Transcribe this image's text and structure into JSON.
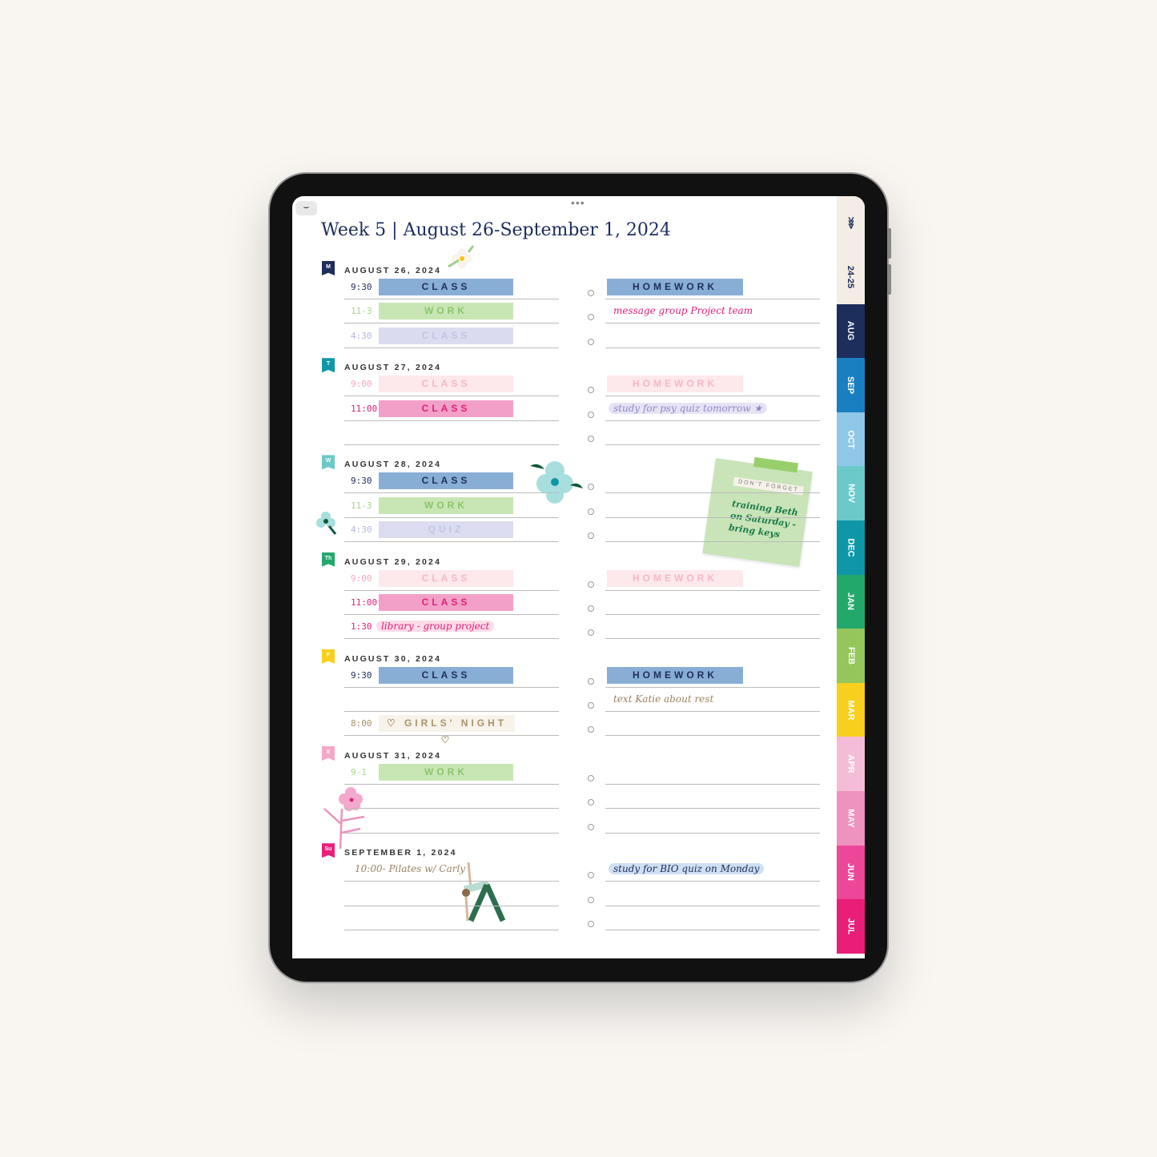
{
  "header": {
    "title": "Week 5  |  August 26-September 1, 2024",
    "collapse_icon": "chevron-down-icon",
    "more_icon": "ellipsis-icon"
  },
  "days": [
    {
      "badge": "M",
      "badge_color": "#1d2d5c",
      "date": "AUGUST 26, 2024",
      "left": [
        {
          "time": "9:30",
          "label": "CLASS",
          "style": "blue"
        },
        {
          "time": "11-3",
          "label": "WORK",
          "style": "green"
        },
        {
          "time": "4:30",
          "label": "CLASS",
          "style": "lavender"
        }
      ],
      "right": [
        {
          "label": "HOMEWORK",
          "style": "blue"
        },
        {
          "text": "message group Project team",
          "style": "hand-pink"
        },
        {}
      ]
    },
    {
      "badge": "T",
      "badge_color": "#0f97a8",
      "date": "AUGUST 27, 2024",
      "left": [
        {
          "time": "9:00",
          "label": "CLASS",
          "style": "pinklight"
        },
        {
          "time": "11:00",
          "label": "CLASS",
          "style": "pink"
        },
        {}
      ],
      "right": [
        {
          "label": "HOMEWORK",
          "style": "pinklight"
        },
        {
          "text": "study for psy quiz tomorrow ★",
          "style": "hand-lavender"
        },
        {}
      ]
    },
    {
      "badge": "W",
      "badge_color": "#6cc9c9",
      "date": "AUGUST 28, 2024",
      "left": [
        {
          "time": "9:30",
          "label": "CLASS",
          "style": "blue"
        },
        {
          "time": "11-3",
          "label": "WORK",
          "style": "green"
        },
        {
          "time": "4:30",
          "label": "QUIZ",
          "style": "lavender"
        }
      ],
      "right": [
        {},
        {},
        {}
      ]
    },
    {
      "badge": "Th",
      "badge_color": "#23a86b",
      "date": "AUGUST 29, 2024",
      "left": [
        {
          "time": "9:00",
          "label": "CLASS",
          "style": "pinklight"
        },
        {
          "time": "11:00",
          "label": "CLASS",
          "style": "pink"
        },
        {
          "time": "1:30",
          "text": "library - group project",
          "style": "hand-pinkhl"
        }
      ],
      "right": [
        {
          "label": "HOMEWORK",
          "style": "pinklight"
        },
        {},
        {}
      ]
    },
    {
      "badge": "F",
      "badge_color": "#f8cf1c",
      "date": "AUGUST 30, 2024",
      "left": [
        {
          "time": "9:30",
          "label": "CLASS",
          "style": "blue"
        },
        {},
        {
          "time": "8:00",
          "label": "♡ GIRLS' NIGHT ♡",
          "style": "beige"
        }
      ],
      "right": [
        {
          "label": "HOMEWORK",
          "style": "blue"
        },
        {
          "text": "text Katie about rest",
          "style": "hand-brown"
        },
        {}
      ]
    },
    {
      "badge": "S",
      "badge_color": "#f2a8c9",
      "date": "AUGUST 31, 2024",
      "left": [
        {
          "time": "9-1",
          "label": "WORK",
          "style": "green"
        },
        {},
        {}
      ],
      "right": [
        {},
        {},
        {}
      ]
    },
    {
      "badge": "Su",
      "badge_color": "#e91e78",
      "date": "SEPTEMBER 1, 2024",
      "left": [
        {
          "time": "",
          "text": "10:00- Pilates w/ Carly",
          "style": "hand-brown"
        },
        {},
        {}
      ],
      "right": [
        {
          "text": "study for BIO quiz on Monday",
          "style": "hand-bluehl"
        },
        {},
        {}
      ]
    }
  ],
  "sticky": {
    "heading": "DON'T FORGET",
    "note": "training Beth on Saturday - bring keys"
  },
  "tabs": [
    {
      "label": "",
      "icon": "pineapple-icon",
      "color": "#f3ede5",
      "text": "#1d2d5c"
    },
    {
      "label": "24-25",
      "color": "#f3ede5",
      "text": "#1d2d5c"
    },
    {
      "label": "AUG",
      "color": "#1d2d5c",
      "text": "#fff"
    },
    {
      "label": "SEP",
      "color": "#1a7fc1",
      "text": "#fff"
    },
    {
      "label": "OCT",
      "color": "#8fc7e8",
      "text": "#fff"
    },
    {
      "label": "NOV",
      "color": "#6cc9c9",
      "text": "#fff"
    },
    {
      "label": "DEC",
      "color": "#0f97a8",
      "text": "#fff"
    },
    {
      "label": "JAN",
      "color": "#23a86b",
      "text": "#fff"
    },
    {
      "label": "FEB",
      "color": "#94c65b",
      "text": "#fff"
    },
    {
      "label": "MAR",
      "color": "#f8cf1c",
      "text": "#fff"
    },
    {
      "label": "APR",
      "color": "#f4bcd6",
      "text": "#fff"
    },
    {
      "label": "MAY",
      "color": "#ee93bf",
      "text": "#fff"
    },
    {
      "label": "JUN",
      "color": "#ec4798",
      "text": "#fff"
    },
    {
      "label": "JUL",
      "color": "#e91e78",
      "text": "#fff"
    }
  ],
  "styles": {
    "blue": {
      "bg": "#88aed6",
      "fg": "#1d2d5c",
      "time": "#1d2d5c"
    },
    "green": {
      "bg": "#c8e6b4",
      "fg": "#8cc46a",
      "time": "#a9d58c"
    },
    "lavender": {
      "bg": "#dcdcf0",
      "fg": "#c2c4e4",
      "time": "#b4b6dc"
    },
    "pinklight": {
      "bg": "#fde8ec",
      "fg": "#f4b8c8",
      "time": "#f4a8c0"
    },
    "pink": {
      "bg": "#f3a0c8",
      "fg": "#e0207a",
      "time": "#e0207a"
    },
    "beige": {
      "bg": "#f8f3ea",
      "fg": "#a8926c",
      "time": "#a8926c"
    },
    "hand-pink": {
      "bg": "transparent",
      "fg": "#e0207a",
      "time": "#e0207a"
    },
    "hand-lavender": {
      "bg": "#e6e4f4",
      "fg": "#8e88c8",
      "time": "#8e88c8"
    },
    "hand-pinkhl": {
      "bg": "#fbdce8",
      "fg": "#e0207a",
      "time": "#e0207a"
    },
    "hand-brown": {
      "bg": "transparent",
      "fg": "#9a8262",
      "time": "#9a8262"
    },
    "hand-bluehl": {
      "bg": "#cfe0f2",
      "fg": "#1d2d5c",
      "time": "#1d2d5c"
    }
  }
}
